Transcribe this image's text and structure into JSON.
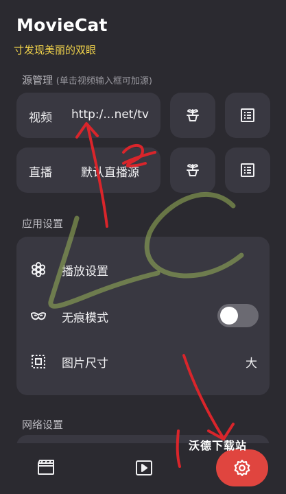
{
  "app": {
    "title": "MovieCat",
    "slogan": "寸发现美丽的双眼"
  },
  "source_section": {
    "title": "源管理",
    "hint": "(单击视频输入框可加源)",
    "rows": [
      {
        "label": "视频",
        "value": "http:/...net/tv",
        "icons": [
          "plant-icon",
          "list-icon"
        ]
      },
      {
        "label": "直播",
        "value": "默认直播源",
        "icons": [
          "plant-icon",
          "list-icon"
        ]
      }
    ]
  },
  "app_section": {
    "title": "应用设置",
    "items": [
      {
        "label": "播放设置",
        "icon": "flower-icon"
      },
      {
        "label": "无痕模式",
        "icon": "mask-icon",
        "toggle_on": false
      },
      {
        "label": "图片尺寸",
        "icon": "image-size-icon",
        "value": "大"
      }
    ]
  },
  "network_section": {
    "title": "网络设置"
  },
  "watermark": "沃德下载站",
  "nav": {
    "items": [
      "film-icon",
      "play-icon",
      "gear-icon"
    ],
    "active": "gear-icon"
  },
  "colors": {
    "accent": "#e0453f",
    "slogan": "#f1d34b",
    "annotation_red": "#d9252b",
    "annotation_green": "#9ab55a"
  }
}
